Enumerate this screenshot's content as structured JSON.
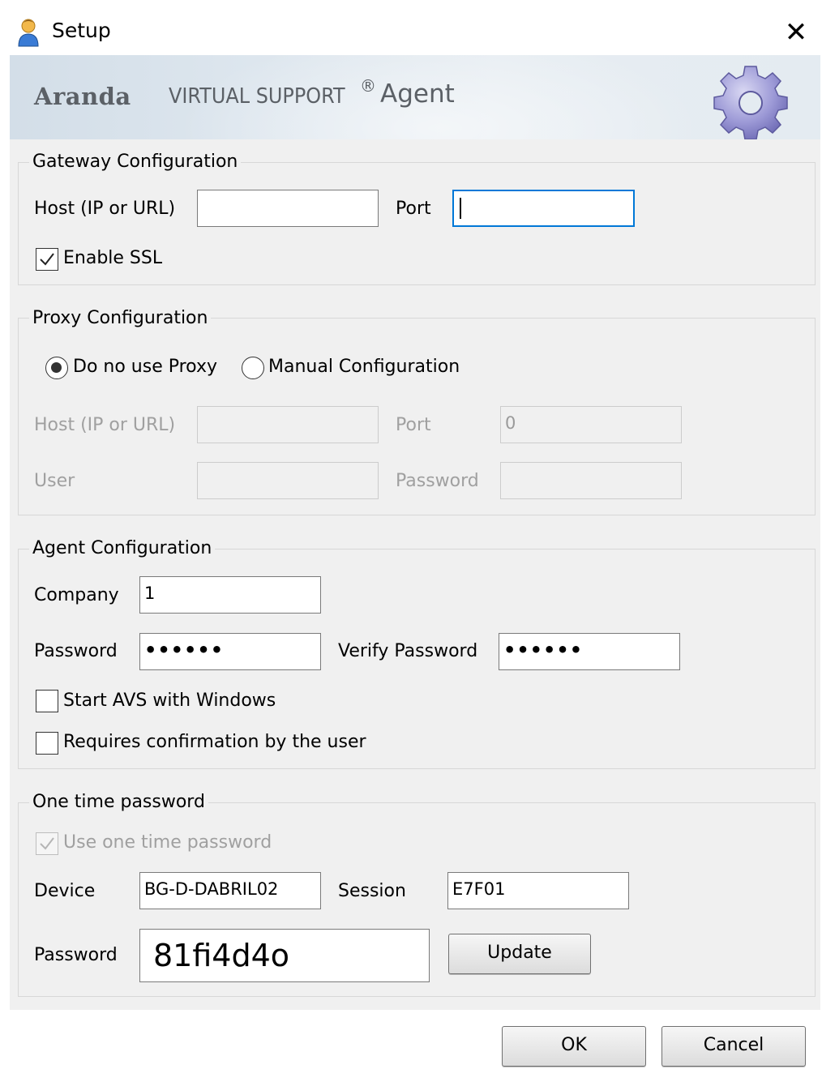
{
  "window": {
    "title": "Setup",
    "close_glyph": "✕",
    "icon": "user-icon"
  },
  "banner": {
    "brand": "Aranda",
    "product": "VIRTUAL SUPPORT",
    "registered": "®",
    "suffix": "Agent",
    "icon": "gear-icon"
  },
  "gateway": {
    "legend": "Gateway Configuration",
    "host_label": "Host (IP or URL)",
    "host_value": "",
    "port_label": "Port",
    "port_value": "",
    "ssl_label": "Enable SSL",
    "ssl_checked": true
  },
  "proxy": {
    "legend": "Proxy Configuration",
    "option_none": "Do no use Proxy",
    "option_manual": "Manual Configuration",
    "selected": "none",
    "host_label": "Host (IP or URL)",
    "host_value": "",
    "port_label": "Port",
    "port_value": "0",
    "user_label": "User",
    "user_value": "",
    "password_label": "Password",
    "password_value": ""
  },
  "agent": {
    "legend": "Agent Configuration",
    "company_label": "Company",
    "company_value": "1",
    "password_label": "Password",
    "password_mask": "••••••",
    "verify_label": "Verify Password",
    "verify_mask": "••••••",
    "start_windows_label": "Start AVS with Windows",
    "start_windows_checked": false,
    "confirm_label": "Requires confirmation by the user",
    "confirm_checked": false
  },
  "otp": {
    "legend": "One time password",
    "use_label": "Use one time password",
    "use_checked": true,
    "device_label": "Device",
    "device_value": "BG-D-DABRIL02",
    "session_label": "Session",
    "session_value": "E7F01",
    "password_label": "Password",
    "password_value": "81fi4d4o",
    "update_label": "Update"
  },
  "footer": {
    "ok_label": "OK",
    "cancel_label": "Cancel"
  },
  "colors": {
    "focus": "#0078d7",
    "dialog_bg": "#f0f0f0",
    "banner_text": "#5b6066",
    "gear": "#8a87c9"
  }
}
